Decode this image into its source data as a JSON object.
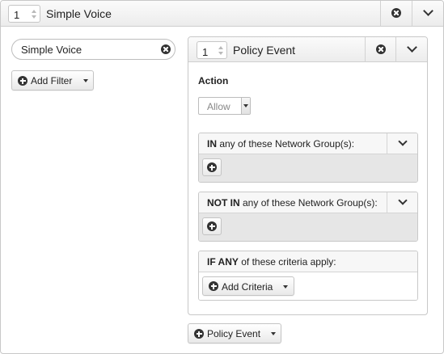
{
  "rule": {
    "order": "1",
    "title": "Simple Voice",
    "close_icon": "circle-x-icon",
    "collapse_icon": "chevron-down-icon"
  },
  "filter": {
    "search_value": "Simple Voice",
    "search_placeholder": "",
    "clear_icon": "circle-x-icon",
    "add_filter_label": "Add Filter"
  },
  "policy_event": {
    "order": "1",
    "title": "Policy Event",
    "action_label": "Action",
    "action_selected": "Allow",
    "in_groups": {
      "keyword": "IN",
      "text": " any of these Network Group(s):"
    },
    "not_in_groups": {
      "keyword": "NOT IN",
      "text": " any of these Network Group(s):"
    },
    "criteria": {
      "keyword": "IF ANY",
      "text": " of these criteria apply:",
      "add_label": "Add Criteria"
    }
  },
  "add_policy_event_label": "Policy Event",
  "colors": {
    "header_top": "#fbfbfb",
    "header_bottom": "#ececec",
    "border": "#c8c8c8",
    "group_body": "#e6e6e6",
    "icon": "#333333"
  }
}
